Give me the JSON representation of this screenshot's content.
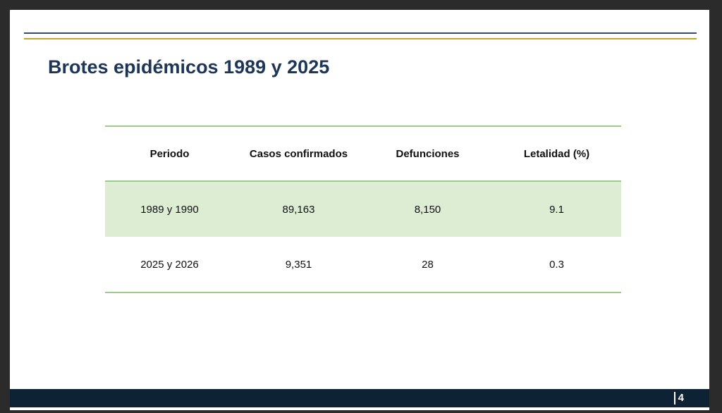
{
  "slide": {
    "title": "Brotes epidémicos 1989 y 2025",
    "page_number": "4"
  },
  "table": {
    "headers": [
      "Periodo",
      "Casos confirmados",
      "Defunciones",
      "Letalidad (%)"
    ],
    "rows": [
      [
        "1989 y 1990",
        "89,163",
        "8,150",
        "9.1"
      ],
      [
        "2025 y 2026",
        "9,351",
        "28",
        "0.3"
      ]
    ]
  },
  "colors": {
    "title": "#1d3557",
    "navy_rule": "#3b4a6b",
    "gold_rule": "#c9a227",
    "table_border": "#9ccc8b",
    "row_shade": "#dcedd3",
    "footer": "#0d2235"
  }
}
